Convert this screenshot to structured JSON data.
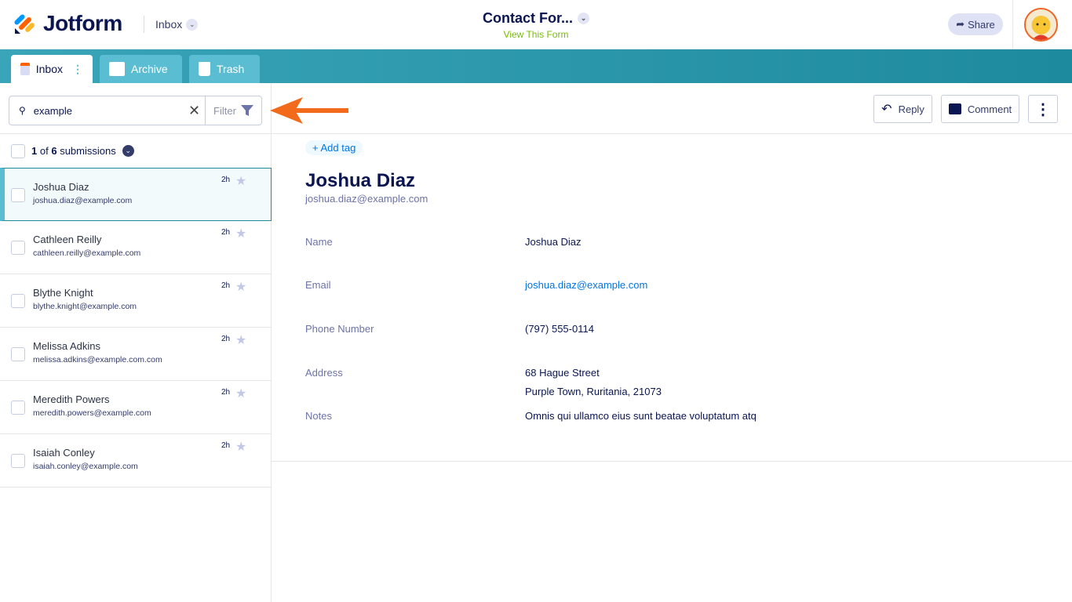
{
  "header": {
    "brand": "Jotform",
    "inbox_dropdown": "Inbox",
    "form_title": "Contact For...",
    "view_form": "View This Form",
    "share": "Share"
  },
  "tabs": [
    {
      "label": "Inbox"
    },
    {
      "label": "Archive"
    },
    {
      "label": "Trash"
    }
  ],
  "search": {
    "value": "example",
    "filter": "Filter"
  },
  "count": {
    "current": "1",
    "of": "of",
    "total": "6",
    "suffix": "submissions"
  },
  "submissions": [
    {
      "name": "Joshua Diaz",
      "email": "joshua.diaz@example.com",
      "time": "2h"
    },
    {
      "name": "Cathleen Reilly",
      "email": "cathleen.reilly@example.com",
      "time": "2h"
    },
    {
      "name": "Blythe Knight",
      "email": "blythe.knight@example.com",
      "time": "2h"
    },
    {
      "name": "Melissa Adkins",
      "email": "melissa.adkins@example.com.com",
      "time": "2h"
    },
    {
      "name": "Meredith Powers",
      "email": "meredith.powers@example.com",
      "time": "2h"
    },
    {
      "name": "Isaiah Conley",
      "email": "isaiah.conley@example.com",
      "time": "2h"
    }
  ],
  "actions": {
    "reply": "Reply",
    "comment": "Comment"
  },
  "detail": {
    "add_tag": "+ Add tag",
    "name": "Joshua Diaz",
    "email": "joshua.diaz@example.com",
    "fields": [
      {
        "label": "Name",
        "value": "Joshua Diaz"
      },
      {
        "label": "Email",
        "value": "joshua.diaz@example.com"
      },
      {
        "label": "Phone Number",
        "value": "(797) 555-0114"
      },
      {
        "label": "Address",
        "value": "68 Hague Street",
        "value2": "Purple Town, Ruritania, 21073"
      },
      {
        "label": "Notes",
        "value": "Omnis qui ullamco eius sunt beatae voluptatum atq"
      }
    ]
  },
  "colors": {
    "accent": "#1e8a9e",
    "arrow": "#f26a1b",
    "link": "#0075e3"
  }
}
